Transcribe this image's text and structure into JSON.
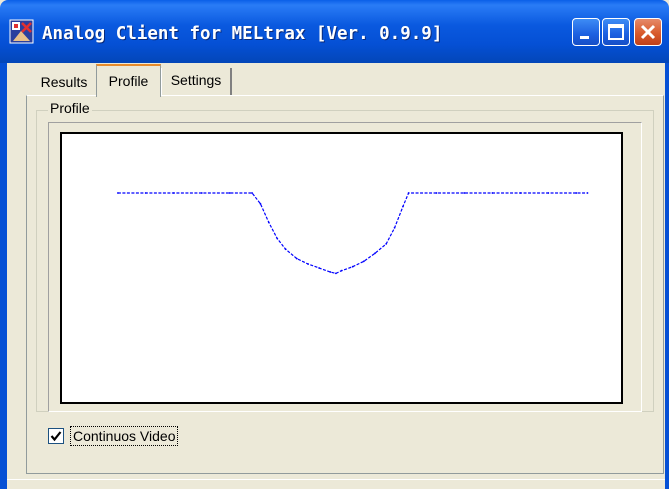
{
  "window": {
    "title": "Analog Client for MELtrax [Ver. 0.9.9]",
    "icons": {
      "app": "app-icon",
      "minimize": "minimize-icon",
      "maximize": "maximize-icon",
      "close": "close-icon"
    },
    "colors": {
      "titlebar": "#0550d5",
      "face": "#ece9d8",
      "close": "#d95a2c",
      "trace": "#0000ff"
    }
  },
  "tabs": [
    {
      "label": "Results",
      "selected": false
    },
    {
      "label": "Profile",
      "selected": true
    },
    {
      "label": "Settings",
      "selected": false
    }
  ],
  "profile_group": {
    "label": "Profile"
  },
  "chart_data": {
    "type": "line",
    "title": "",
    "xlabel": "",
    "ylabel": "",
    "grid": false,
    "xlim": [
      0,
      100
    ],
    "ylim": [
      0,
      100
    ],
    "series": [
      {
        "values": [
          [
            10.0,
            78.0
          ],
          [
            15.0,
            78.0
          ],
          [
            20.0,
            78.0
          ],
          [
            25.0,
            78.0
          ],
          [
            30.0,
            78.0
          ],
          [
            34.0,
            78.0
          ],
          [
            35.5,
            74.0
          ],
          [
            37.0,
            67.0
          ],
          [
            38.5,
            61.0
          ],
          [
            40.0,
            57.0
          ],
          [
            42.0,
            53.5
          ],
          [
            44.0,
            51.5
          ],
          [
            46.0,
            50.0
          ],
          [
            48.0,
            48.5
          ],
          [
            49.0,
            48.0
          ],
          [
            50.0,
            49.0
          ],
          [
            52.0,
            50.5
          ],
          [
            54.0,
            52.5
          ],
          [
            56.0,
            55.5
          ],
          [
            58.0,
            59.0
          ],
          [
            59.5,
            65.0
          ],
          [
            61.0,
            73.0
          ],
          [
            62.0,
            78.0
          ],
          [
            67.0,
            78.0
          ],
          [
            72.0,
            78.0
          ],
          [
            77.0,
            78.0
          ],
          [
            82.0,
            78.0
          ],
          [
            87.0,
            78.0
          ],
          [
            92.0,
            78.0
          ],
          [
            94.0,
            78.0
          ]
        ]
      }
    ]
  },
  "checkbox": {
    "label": "Continuos Video",
    "checked": true,
    "check_glyph": "✔"
  }
}
